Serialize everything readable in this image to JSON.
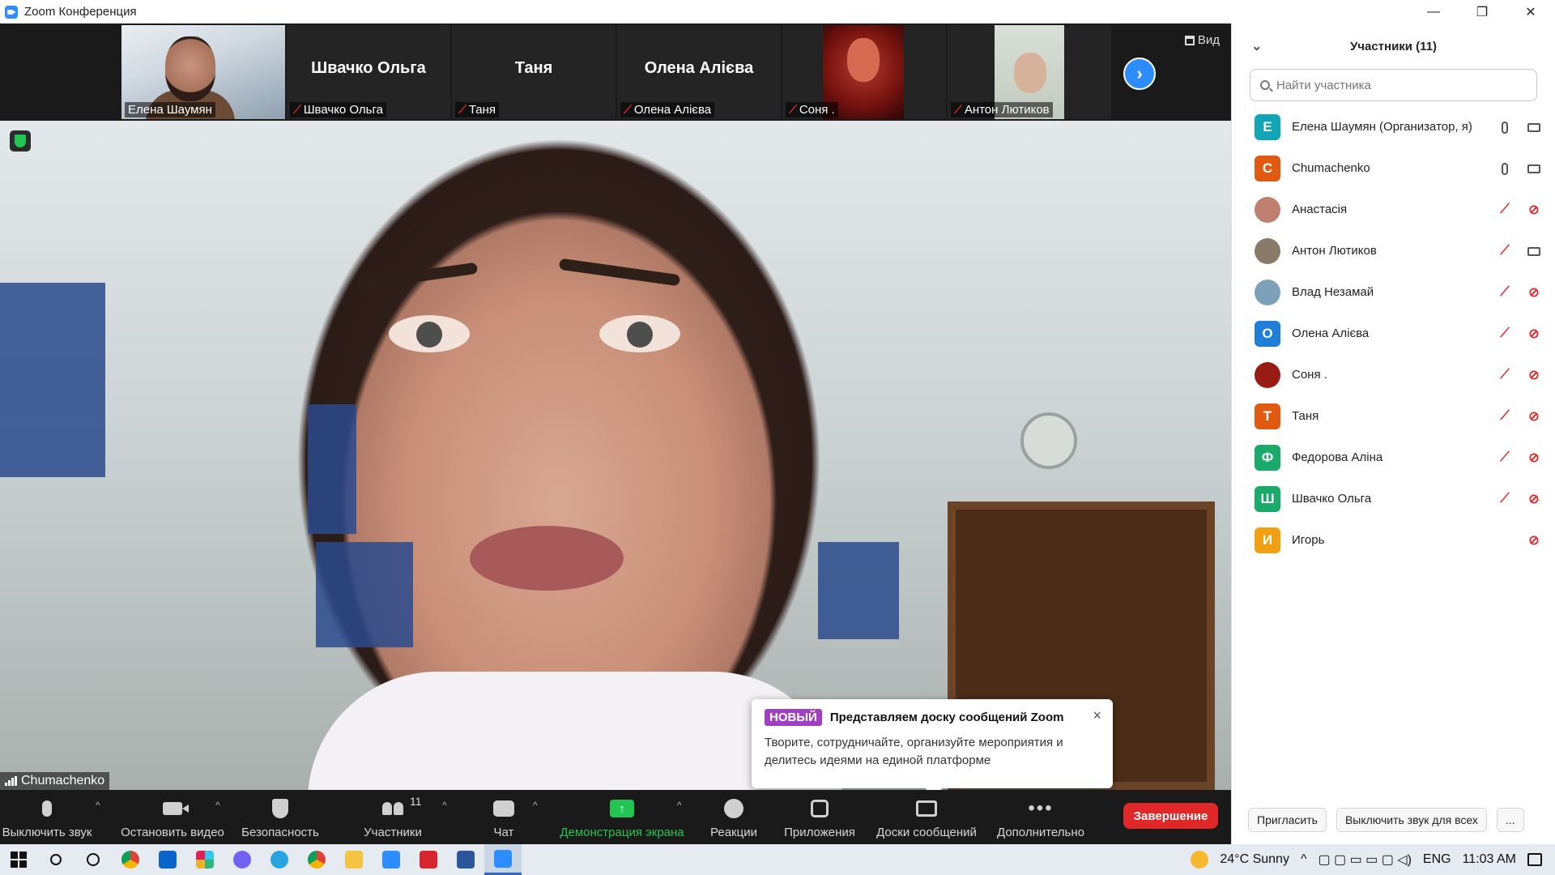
{
  "window": {
    "title": "Zoom Конференция",
    "minimize": "—",
    "restore": "❐",
    "close": "✕"
  },
  "strip": {
    "tiles": [
      {
        "label": "Елена Шаумян",
        "big": "",
        "muted": false
      },
      {
        "label": "Швачко Ольга",
        "big": "Швачко Ольга",
        "muted": true
      },
      {
        "label": "Таня",
        "big": "Таня",
        "muted": true
      },
      {
        "label": "Олена Алієва",
        "big": "Олена Алієва",
        "muted": true
      },
      {
        "label": "Соня .",
        "big": "",
        "muted": true
      },
      {
        "label": "Антон Лютиков",
        "big": "",
        "muted": true
      }
    ],
    "next_icon": "›",
    "view_label": "Вид"
  },
  "main_video": {
    "speaker_name": "Chumachenko"
  },
  "toast": {
    "badge": "НОВЫЙ",
    "title": "Представляем доску сообщений Zoom",
    "body": "Творите, сотрудничайте, организуйте мероприятия и делитесь идеями на единой платформе",
    "close": "×"
  },
  "toolbar": {
    "mute_label": "Выключить звук",
    "video_label": "Остановить видео",
    "security_label": "Безопасность",
    "participants_label": "Участники",
    "participants_count": "11",
    "chat_label": "Чат",
    "share_label": "Демонстрация экрана",
    "reactions_label": "Реакции",
    "apps_label": "Приложения",
    "boards_label": "Доски сообщений",
    "more_label": "Дополнительно",
    "end_label": "Завершение",
    "caret": "^"
  },
  "panel": {
    "title": "Участники (11)",
    "collapse_icon": "⌄",
    "search_placeholder": "Найти участника",
    "participants": [
      {
        "initial": "E",
        "name": "Елена Шаумян (Организатор, я)",
        "color": "#12a5b8",
        "mic": "on",
        "cam": "on"
      },
      {
        "initial": "C",
        "name": "Chumachenko",
        "color": "#e05a12",
        "mic": "on",
        "cam": "on"
      },
      {
        "initial": "",
        "name": "Анастасія",
        "color": "#c08070",
        "mic": "off",
        "cam": "off"
      },
      {
        "initial": "",
        "name": "Антон Лютиков",
        "color": "#8a7a6a",
        "mic": "off",
        "cam": "on"
      },
      {
        "initial": "",
        "name": "Влад Незамай",
        "color": "#7ea0b8",
        "mic": "off",
        "cam": "off"
      },
      {
        "initial": "O",
        "name": "Олена Алієва",
        "color": "#1f7fd8",
        "mic": "off",
        "cam": "off"
      },
      {
        "initial": "",
        "name": "Соня .",
        "color": "#9a1a14",
        "mic": "off",
        "cam": "off"
      },
      {
        "initial": "T",
        "name": "Таня",
        "color": "#e05a12",
        "mic": "off",
        "cam": "off"
      },
      {
        "initial": "Ф",
        "name": "Федорова Аліна",
        "color": "#1aaa6a",
        "mic": "off",
        "cam": "off"
      },
      {
        "initial": "Ш",
        "name": "Швачко Ольга",
        "color": "#1aaa6a",
        "mic": "off",
        "cam": "off"
      },
      {
        "initial": "И",
        "name": "Игорь",
        "color": "#f0a010",
        "mic": "none",
        "cam": "off"
      }
    ],
    "invite_label": "Пригласить",
    "mute_all_label": "Выключить звук для всех",
    "more_label": "..."
  },
  "taskbar": {
    "weather": "24°C  Sunny",
    "language": "ENG",
    "time": "11:03 AM"
  },
  "colors": {
    "accent": "#2d8cff",
    "end_red": "#e02828",
    "share_green": "#23c552",
    "new_badge": "#a13fc3"
  }
}
